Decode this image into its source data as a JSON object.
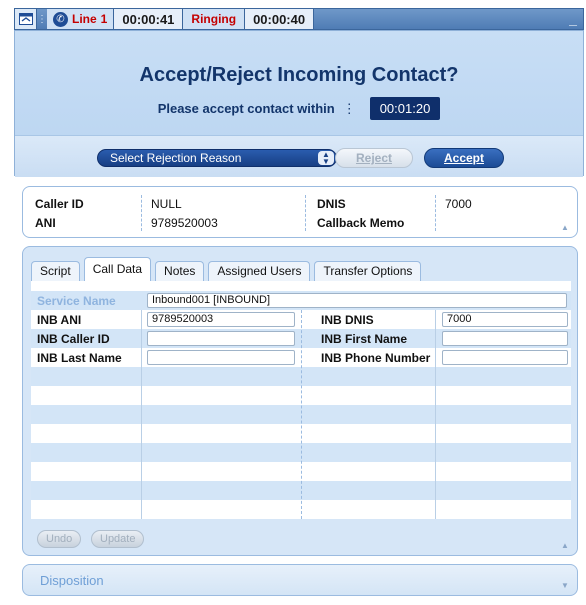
{
  "status_bar": {
    "line_label": "Line",
    "line_number": "1",
    "call_time": "00:00:41",
    "state": "Ringing",
    "state_time": "00:00:40",
    "minimize": "_"
  },
  "accept_panel": {
    "title": "Accept/Reject Incoming Contact?",
    "message": "Please accept contact within",
    "countdown": "00:01:20",
    "rejection_reason_placeholder": "Select Rejection Reason",
    "reject_label": "Reject",
    "accept_label": "Accept"
  },
  "caller_info": {
    "caller_id_label": "Caller ID",
    "caller_id_value": "NULL",
    "ani_label": "ANI",
    "ani_value": "9789520003",
    "dnis_label": "DNIS",
    "dnis_value": "7000",
    "callback_memo_label": "Callback Memo",
    "callback_memo_value": ""
  },
  "tabs": [
    {
      "label": "Script"
    },
    {
      "label": "Call Data",
      "active": true
    },
    {
      "label": "Notes"
    },
    {
      "label": "Assigned Users"
    },
    {
      "label": "Transfer Options"
    }
  ],
  "call_data": {
    "service_name_label": "Service Name",
    "service_name_value": "Inbound001 [INBOUND]",
    "inb_ani_label": "INB ANI",
    "inb_ani_value": "9789520003",
    "inb_dnis_label": "INB DNIS",
    "inb_dnis_value": "7000",
    "inb_caller_id_label": "INB Caller ID",
    "inb_caller_id_value": "",
    "inb_first_name_label": "INB First Name",
    "inb_first_name_value": "",
    "inb_last_name_label": "INB Last Name",
    "inb_last_name_value": "",
    "inb_phone_number_label": "INB Phone Number",
    "inb_phone_number_value": "",
    "undo_label": "Undo",
    "update_label": "Update"
  },
  "disposition": {
    "label": "Disposition"
  },
  "icons": {
    "app_icon": "window-icon",
    "phone_icon": "phone-icon",
    "collapse_icon": "chevron-up-icon",
    "expand_icon": "chevron-down-icon"
  },
  "colors": {
    "header_navy": "#13356b",
    "ringing_red": "#c40000",
    "accept_blue": "#1b4b95",
    "service_name_blue": "#8fb4df"
  }
}
